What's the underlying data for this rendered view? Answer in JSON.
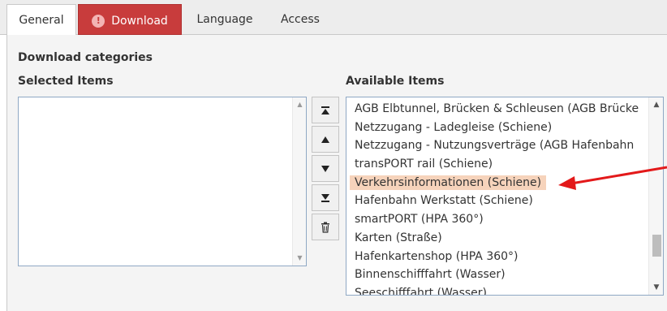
{
  "tabs": [
    {
      "label": "General"
    },
    {
      "label": "Download",
      "error_icon": "!"
    },
    {
      "label": "Language"
    },
    {
      "label": "Access"
    }
  ],
  "section_title": "Download categories",
  "selected": {
    "label": "Selected Items"
  },
  "available": {
    "label": "Available Items",
    "items": [
      "AGB Elbtunnel, Brücken & Schleusen (AGB Brücke",
      "Netzzugang - Ladegleise (Schiene)",
      "Netzzugang - Nutzungsverträge (AGB Hafenbahn",
      "transPORT rail (Schiene)",
      "Verkehrsinformationen (Schiene)",
      "Hafenbahn Werkstatt (Schiene)",
      "smartPORT (HPA 360°)",
      "Karten (Straße)",
      "Hafenkartenshop (HPA 360°)",
      "Binnenschifffahrt (Wasser)",
      "Seeschifffahrt (Wasser)"
    ],
    "highlighted_index": 4
  },
  "controls": [
    {
      "icon": "move-to-top-icon"
    },
    {
      "icon": "move-up-icon"
    },
    {
      "icon": "move-down-icon"
    },
    {
      "icon": "move-to-bottom-icon"
    },
    {
      "icon": "trash-icon"
    }
  ],
  "colors": {
    "active_tab": "#c83c3c",
    "highlight": "#f6d3bb",
    "annotation_arrow": "#e3191a"
  }
}
